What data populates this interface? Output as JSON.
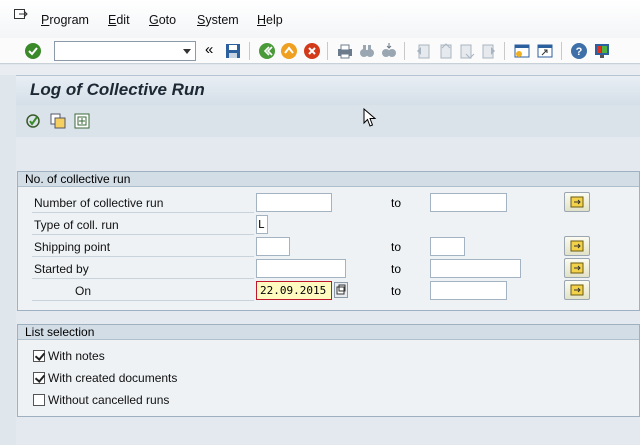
{
  "menu": {
    "items": [
      {
        "label": "Program",
        "mnemonic": "P",
        "rest": "rogram"
      },
      {
        "label": "Edit",
        "mnemonic": "E",
        "rest": "dit"
      },
      {
        "label": "Goto",
        "mnemonic": "G",
        "rest": "oto"
      },
      {
        "label": "System",
        "mnemonic": "S",
        "rest": "ystem"
      },
      {
        "label": "Help",
        "mnemonic": "H",
        "rest": "elp"
      }
    ]
  },
  "toolbar": {
    "command_field_value": "",
    "collapse_symbol": "«"
  },
  "page": {
    "title": "Log of Collective Run"
  },
  "group_collective": {
    "title": "No. of collective run",
    "to_label": "to",
    "fields": [
      {
        "label": "Number of collective run",
        "value": "",
        "to_value": ""
      },
      {
        "label": "Type of coll. run",
        "value": "L"
      },
      {
        "label": "Shipping point",
        "value": "",
        "to_value": ""
      },
      {
        "label": "Started by",
        "value": "",
        "to_value": ""
      },
      {
        "label": "On",
        "value": "22.09.2015",
        "to_value": ""
      }
    ]
  },
  "group_list": {
    "title": "List selection",
    "options": [
      {
        "label": "With notes",
        "checked": true
      },
      {
        "label": "With created documents",
        "checked": true
      },
      {
        "label": "Without cancelled runs",
        "checked": false
      }
    ]
  },
  "colors": {
    "accent_green": "#3a8a2a",
    "required_red": "#c0182a",
    "highlight_yellow": "#fffbc0"
  }
}
